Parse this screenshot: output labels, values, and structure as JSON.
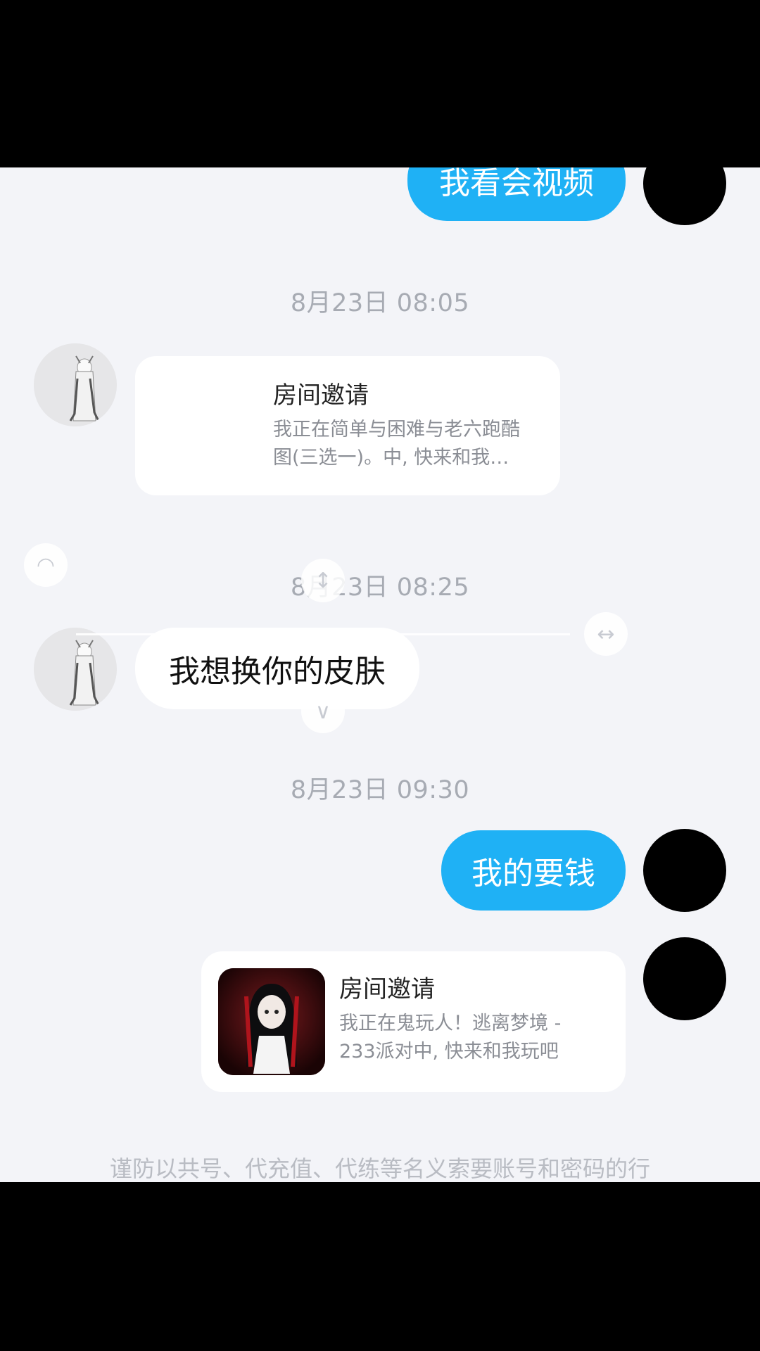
{
  "messages": {
    "top_sent": "我看会视频",
    "ts1": "8月23日 08:05",
    "invite1": {
      "title": "房间邀请",
      "desc_line1": "我正在简单与困难与老六跑酷",
      "desc_line2": "图(三选一)。中, 快来和我…"
    },
    "ts2": "8月23日 08:25",
    "recv_text": "我想换你的皮肤",
    "ts3": "8月23日 09:30",
    "sent_text": "我的要钱",
    "invite2": {
      "title": "房间邀请",
      "desc_line1": "我正在鬼玩人！逃离梦境 -",
      "desc_line2": "233派对中, 快来和我玩吧"
    }
  },
  "notice": "谨防以共号、代充值、代练等名义索要账号和密码的行",
  "colors": {
    "accent_blue": "#1fb1f5",
    "chat_bg": "#f3f4f8",
    "timestamp": "#a7abb3"
  },
  "icons": {
    "handle_top": "resize-vertical-icon",
    "handle_right": "resize-horizontal-icon",
    "handle_bottom": "chevrons-down-icon",
    "handle_left": "crop-corner-icon"
  }
}
